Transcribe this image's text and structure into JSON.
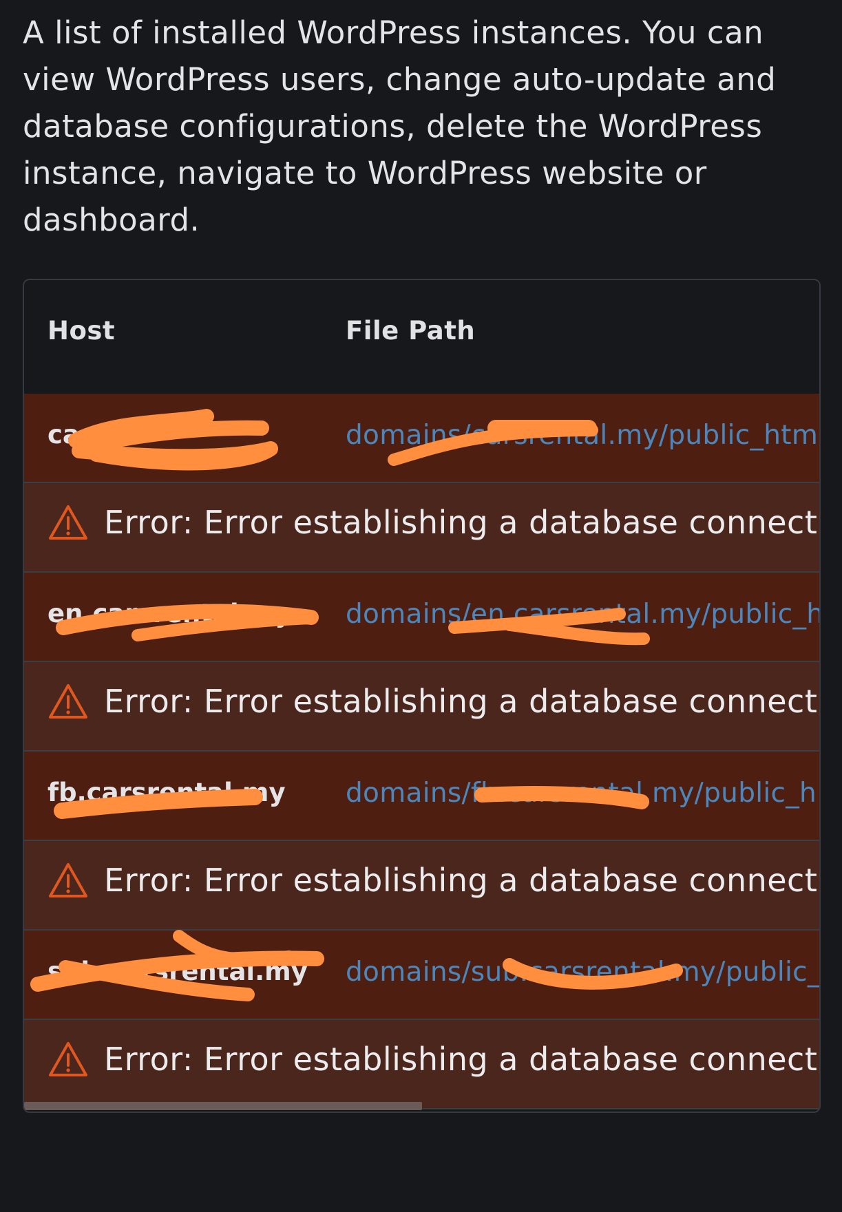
{
  "description": "A list of installed WordPress instances. You can view WordPress users, change auto-update and database configurations, delete the WordPress instance, navigate to WordPress website or dashboard.",
  "table": {
    "headers": {
      "host": "Host",
      "file_path": "File Path"
    },
    "rows": [
      {
        "host": "ca",
        "path": "domains/carsrental.my/public_htm",
        "error": "Error: Error establishing a database connecti"
      },
      {
        "host": "en.carsrental.my",
        "path": "domains/en.carsrental.my/public_h",
        "error": "Error: Error establishing a database connecti"
      },
      {
        "host": "fb.carsrental.my",
        "path": "domains/fb.carsrental.my/public_h",
        "error": "Error: Error establishing a database connecti"
      },
      {
        "host": "sub.carsrental.my",
        "path": "domains/sub.carsrental.my/public_",
        "error": "Error: Error establishing a database connecti"
      }
    ]
  },
  "colors": {
    "background": "#17181b",
    "row_main": "#4e1f11",
    "row_error": "#4a261d",
    "link": "#4d86ba",
    "warning": "#e0581f",
    "redaction": "#ff8f3f"
  },
  "icons": {
    "warning": "warning-triangle-icon"
  }
}
